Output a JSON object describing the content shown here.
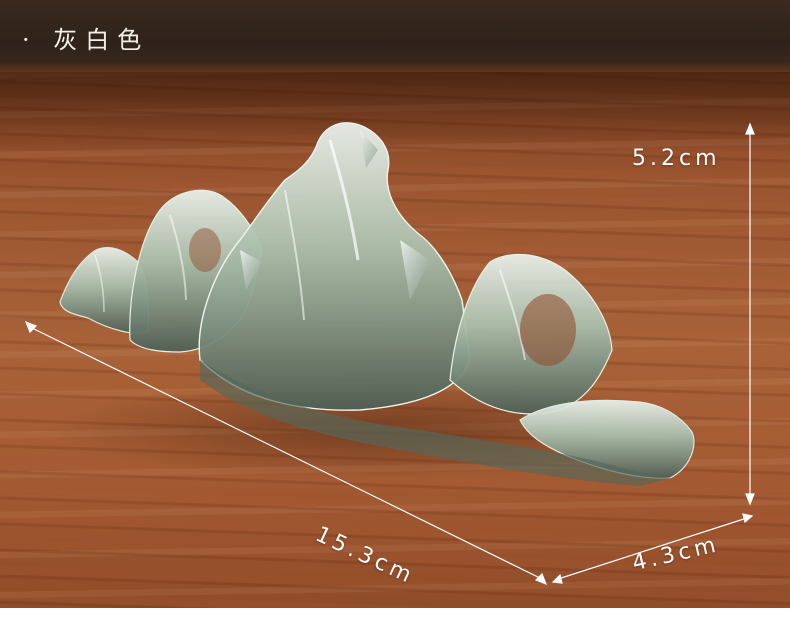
{
  "header": {
    "label": "· 灰白色"
  },
  "dimensions": {
    "height": "5.2cm",
    "length": "15.3cm",
    "width": "4.3cm"
  },
  "colors": {
    "wood": "#a35a32",
    "crystal": "#9fb5a3",
    "guide_line": "#ffffff"
  }
}
